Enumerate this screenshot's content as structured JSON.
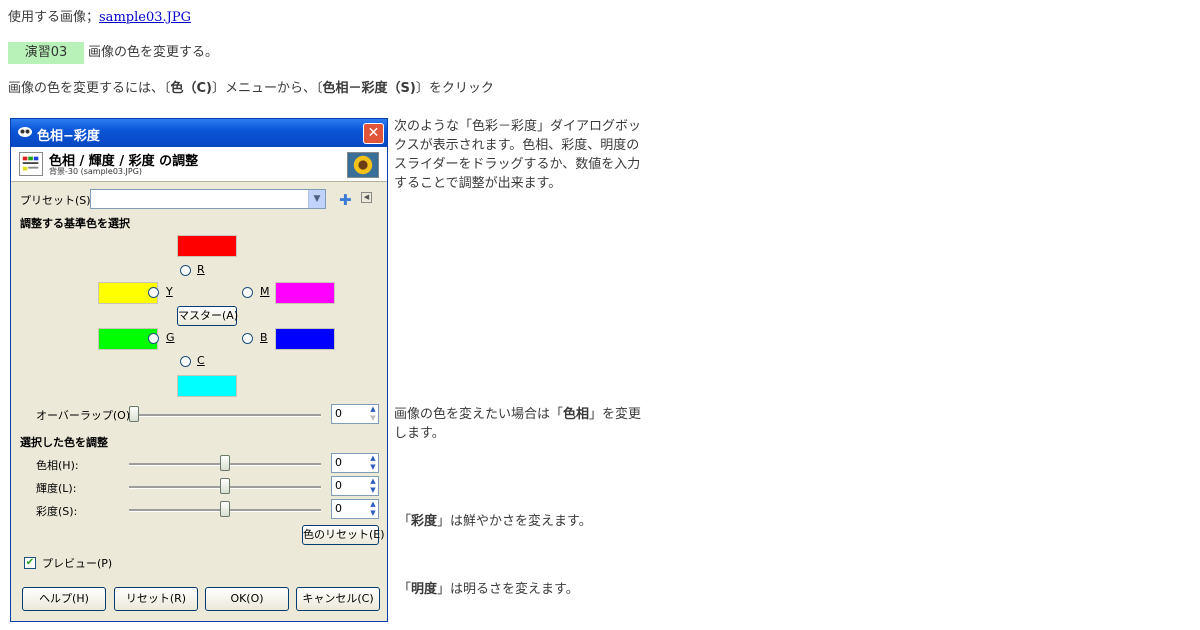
{
  "document": {
    "image_line": {
      "prefix": "使用する画像；",
      "link": "sample03.JPG"
    },
    "exercise": {
      "badge": "演習03",
      "title": "画像の色を変更する。"
    },
    "instruction": {
      "part1": "画像の色を変更するには、〔",
      "menu1": "色（C)",
      "part2": "〕メニューから、〔",
      "menu2": "色相－彩度（S)",
      "part3": "〕をクリック"
    },
    "notes": {
      "dialog_desc": "次のような「色彩－彩度」ダイアログボックスが表示されます。色相、彩度、明度のスライダーをドラッグするか、数値を入力することで調整が出来ます。",
      "hue_pre": "画像の色を変えたい場合は「",
      "hue_term": "色相",
      "hue_post": "」を変更します。",
      "sat_pre": "「",
      "sat_term": "彩度",
      "sat_post": "」は鮮やかさを変えます。",
      "light_pre": "「",
      "light_term": "明度",
      "light_post": "」は明るさを変えます。"
    }
  },
  "dialog": {
    "window_title": "色相−彩度",
    "close_label": "✕",
    "header_title": "色相 / 輝度 / 彩度 の調整",
    "header_subtitle": "背景-30 (sample03.JPG)",
    "preset_label": "プリセット(S):",
    "preset_value": "",
    "section_base_color": "調整する基準色を選択",
    "colors": {
      "R": {
        "label": "R",
        "hex": "#ff0000"
      },
      "Y": {
        "label": "Y",
        "hex": "#ffff00"
      },
      "G": {
        "label": "G",
        "hex": "#00ff00"
      },
      "C": {
        "label": "C",
        "hex": "#00ffff"
      },
      "B": {
        "label": "B",
        "hex": "#0000ff"
      },
      "M": {
        "label": "M",
        "hex": "#ff00ff"
      }
    },
    "master_button": "マスター(A)",
    "overlap": {
      "label": "オーバーラップ(O):",
      "value": "0"
    },
    "section_adjust": "選択した色を調整",
    "hue": {
      "label": "色相(H):",
      "value": "0"
    },
    "lightness": {
      "label": "輝度(L):",
      "value": "0"
    },
    "saturation": {
      "label": "彩度(S):",
      "value": "0"
    },
    "reset_color_button": "色のリセット(E)",
    "preview": {
      "label": "プレビュー(P)",
      "checked": true
    },
    "buttons": {
      "help": "ヘルプ(H)",
      "reset": "リセット(R)",
      "ok": "OK(O)",
      "cancel": "キャンセル(C)"
    }
  }
}
